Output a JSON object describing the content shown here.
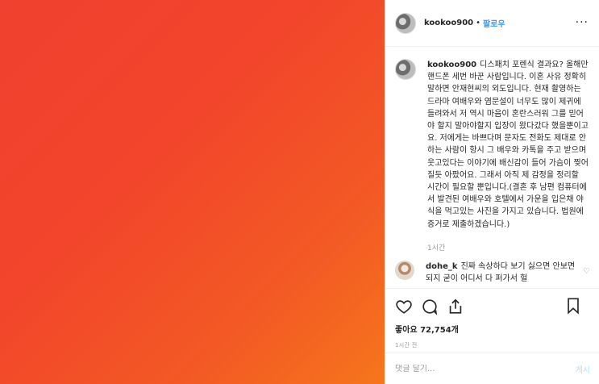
{
  "post": {
    "photo_color_start": "#f0402f",
    "photo_color_end": "#f6761c"
  },
  "header": {
    "username": "kookoo900",
    "separator": "•",
    "follow_label": "팔로우",
    "more_label": "···"
  },
  "caption": {
    "username": "kookoo900",
    "text": "디스패치 포렌식 결과요? 올해만 핸드폰 세번 바꾼 사람입니다. 이혼 사유 정확히 말하면 안재현씨의 외도입니다. 현재 촬영하는 드라마 여배우와 염문설이 너무도 많이 제귀에 들려와서 저 역시 마음이 혼란스러워 그를 믿어야 할지 말아야할지 입장이 왔다갔다 했을뿐이고요. 저에게는 바쁘다며 문자도 전화도 제대로 안하는 사람이 항시 그 배우와 카톡을 주고 받으며 웃고있다는 이야기에 배신감이 들어 가슴이 찢어질듯 아팠어요. 그래서 아직 제 감정을 정리할 시간이 필요할 뿐입니다.(결혼 후 남편 컴퓨터에서 발견된 여배우와 호텔에서 가운을 입은채 야식을 먹고있는 사진을 가지고 있습니다. 법원에 증거로 제출하겠습니다.)",
    "time": "1시간"
  },
  "comments": [
    {
      "username": "dohe_k",
      "text": "진짜 속상하다 보기 싫으면 안보면되지 굳이 어디서 다 퍼가서 헐"
    }
  ],
  "actions": {
    "like_icon": "heart-icon",
    "comment_icon": "comment-icon",
    "share_icon": "share-icon",
    "save_icon": "bookmark-icon",
    "likes_text": "좋아요 72,754개",
    "timestamp": "1시간 전"
  },
  "comment_box": {
    "placeholder": "댓글 달기...",
    "post_label": "게시"
  }
}
